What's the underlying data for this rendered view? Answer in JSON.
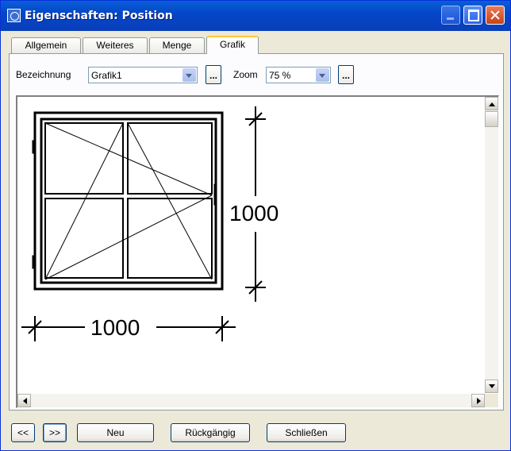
{
  "window": {
    "title": "Eigenschaften: Position"
  },
  "tabs": [
    {
      "label": "Allgemein",
      "active": false
    },
    {
      "label": "Weiteres",
      "active": false
    },
    {
      "label": "Menge",
      "active": false
    },
    {
      "label": "Grafik",
      "active": true
    }
  ],
  "grafik": {
    "bezeichnung_label": "Bezeichnung",
    "bezeichnung_value": "Grafik1",
    "zoom_label": "Zoom",
    "zoom_value": "75 %",
    "browse_label": "...",
    "drawing": {
      "width_dim": "1000",
      "height_dim": "1000"
    }
  },
  "footer": {
    "prev_label": "<<",
    "next_label": ">>",
    "new_label": "Neu",
    "undo_label": "Rückgängig",
    "close_label": "Schließen"
  }
}
